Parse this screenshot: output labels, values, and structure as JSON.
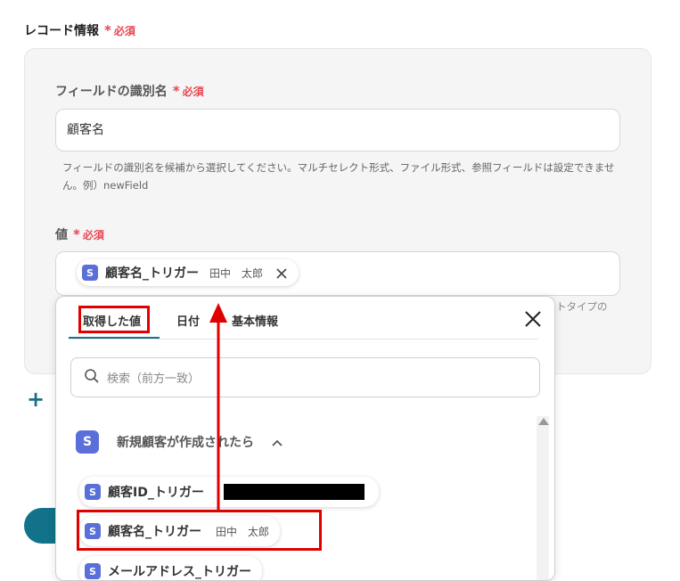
{
  "section": {
    "title": "レコード情報",
    "required": "必須",
    "star": "*"
  },
  "field_id": {
    "label": "フィールドの識別名",
    "required": "必須",
    "value": "顧客名",
    "help": "フィールドの識別名を候補から選択してください。マルチセレクト形式、ファイル形式、参照フィールドは設定できません。例）newField"
  },
  "value_field": {
    "label": "値",
    "required": "必須",
    "chip": {
      "icon": "S",
      "label": "顧客名_トリガー",
      "value": "田中　太郎"
    },
    "hidden_help_tail": "トタイプの"
  },
  "dropdown": {
    "tabs": [
      {
        "label": "取得した値",
        "active": true
      },
      {
        "label": "日付",
        "active": false
      },
      {
        "label": "基本情報",
        "active": false
      }
    ],
    "close": "✕",
    "search_placeholder": "検索（前方一致）",
    "group": {
      "icon": "S",
      "title": "新規顧客が作成されたら",
      "chevron": "^"
    },
    "items": [
      {
        "icon": "S",
        "label": "顧客ID_トリガー",
        "value": "",
        "redacted": true
      },
      {
        "icon": "S",
        "label": "顧客名_トリガー",
        "value": "田中　太郎"
      },
      {
        "icon": "S",
        "label": "メールアドレス_トリガー",
        "value": ""
      }
    ]
  },
  "plus": "+",
  "colors": {
    "accent": "#1d6e87",
    "required": "#e8454f",
    "highlight": "#e00000",
    "service_icon": "#5a6fd8"
  }
}
